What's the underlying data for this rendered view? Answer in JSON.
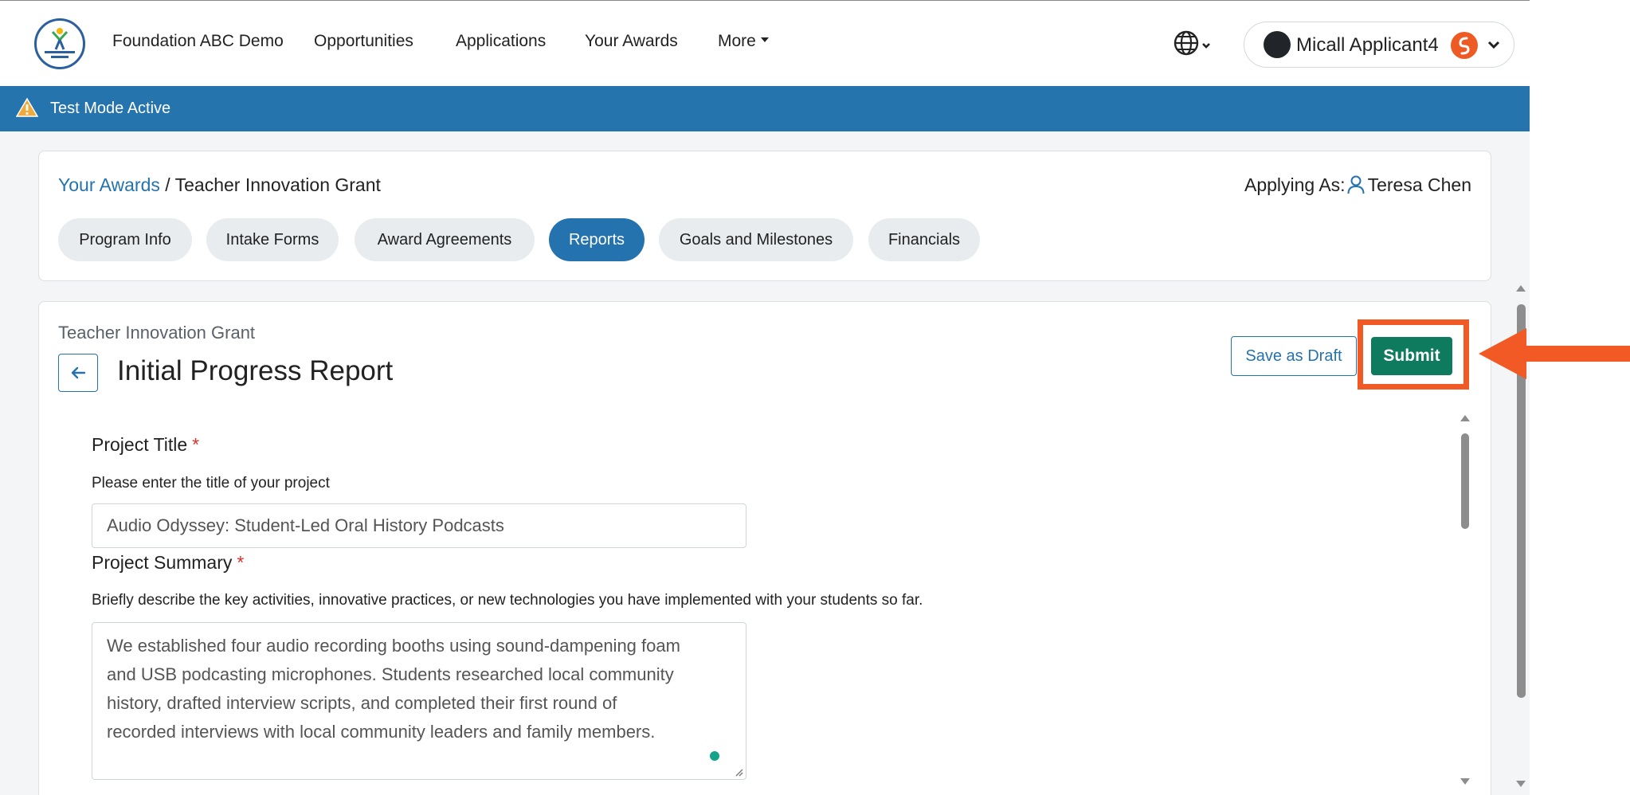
{
  "navbar": {
    "brand": "Foundation ABC Demo",
    "links": [
      "Opportunities",
      "Applications",
      "Your Awards",
      "More"
    ],
    "user_name": "Micall Applicant4",
    "icons": [
      "globe-icon",
      "chevron-down-icon",
      "avatar",
      "user-badge-icon"
    ]
  },
  "test_mode": {
    "label": "Test Mode Active",
    "icon": "warning-icon",
    "color": "#2574ad"
  },
  "breadcrumb": {
    "link": "Your Awards",
    "separator": " / ",
    "current": "Teacher Innovation Grant"
  },
  "applying_as": {
    "label": "Applying As:",
    "name": "Teresa Chen"
  },
  "tabs": [
    {
      "label": "Program Info",
      "active": false
    },
    {
      "label": "Intake Forms",
      "active": false
    },
    {
      "label": "Award Agreements",
      "active": false
    },
    {
      "label": "Reports",
      "active": true
    },
    {
      "label": "Goals and Milestones",
      "active": false
    },
    {
      "label": "Financials",
      "active": false
    }
  ],
  "report": {
    "program": "Teacher Innovation Grant",
    "title": "Initial Progress Report",
    "save_draft_label": "Save as Draft",
    "submit_label": "Submit"
  },
  "form": {
    "project_title": {
      "label": "Project Title",
      "required_mark": "*",
      "help": "Please enter the title of your project",
      "value": "Audio Odyssey: Student-Led Oral History Podcasts"
    },
    "project_summary": {
      "label": "Project Summary",
      "required_mark": "*",
      "help": "Briefly describe the key activities, innovative practices, or new technologies you have implemented with your students so far.",
      "value": "We established four audio recording booths using sound-dampening foam\nand USB podcasting microphones. Students researched local community\nhistory, drafted interview scripts, and completed their first round of\nrecorded interviews with local community leaders and family members."
    }
  },
  "colors": {
    "accent": "#2573ae",
    "submit": "#0e7a5e",
    "highlight": "#f15a24"
  }
}
